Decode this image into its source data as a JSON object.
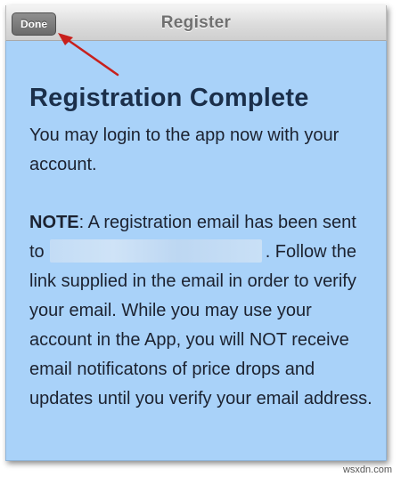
{
  "navbar": {
    "title": "Register",
    "done_label": "Done"
  },
  "content": {
    "heading": "Registration Complete",
    "intro": "You may login to the app now with your account.",
    "note_label": "NOTE",
    "note_before": ": A registration email has been sent to",
    "note_after": ". Follow the link supplied in the email in order to verify your email. While you may use your account in the App, you will NOT receive email notificatons of price drops and updates until you verify your email address."
  },
  "watermark": "wsxdn.com",
  "colors": {
    "content_background": "#a9d2f9",
    "annotation_arrow": "#c8201c",
    "done_button": "#7a7a7a"
  },
  "icons": {
    "annotation": "red-arrow"
  }
}
